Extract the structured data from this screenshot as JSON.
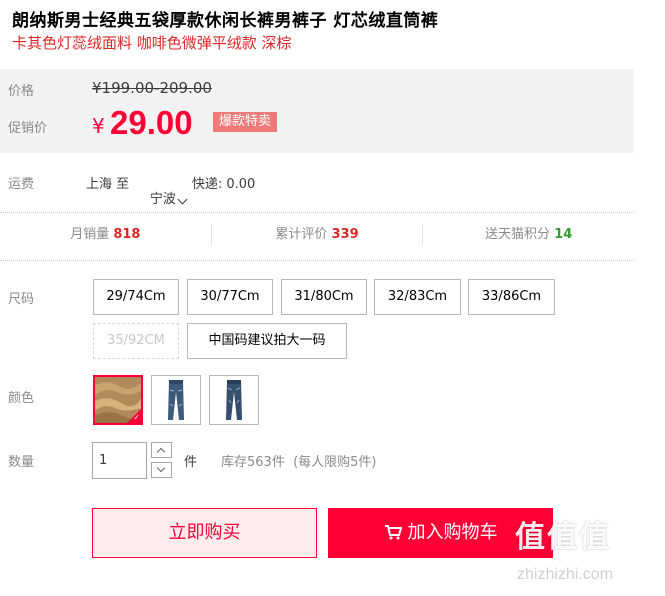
{
  "product": {
    "title": "朗纳斯男士经典五袋厚款休闲长裤男裤子 灯芯绒直筒裤",
    "subtitle": "卡其色灯蕊绒面料 咖啡色微弹平绒款 深棕"
  },
  "price": {
    "label": "价格",
    "original": "¥199.00-209.00",
    "promo_label": "促销价",
    "currency_symbol": "¥",
    "promo_value": "29.00",
    "promo_tag": "爆款特卖"
  },
  "shipping": {
    "label": "运费",
    "from": "上海",
    "to_word": "至",
    "destination": "宁波",
    "method": "快递: 0.00"
  },
  "stats": [
    {
      "label": "月销量",
      "value": "818"
    },
    {
      "label": "累计评价",
      "value": "339"
    },
    {
      "label": "送天猫积分",
      "value": "14"
    }
  ],
  "size": {
    "label": "尺码",
    "options": [
      {
        "label": "29/74Cm",
        "available": true
      },
      {
        "label": "30/77Cm",
        "available": true
      },
      {
        "label": "31/80Cm",
        "available": true
      },
      {
        "label": "32/83Cm",
        "available": true
      },
      {
        "label": "33/86Cm",
        "available": true
      },
      {
        "label": "35/92CM",
        "available": false
      },
      {
        "label": "中国码建议拍大一码",
        "available": true
      }
    ]
  },
  "color": {
    "label": "颜色",
    "options": [
      {
        "name": "khaki-corduroy",
        "selected": true
      },
      {
        "name": "jeans-blue-1",
        "selected": false
      },
      {
        "name": "jeans-blue-2",
        "selected": false
      }
    ]
  },
  "quantity": {
    "label": "数量",
    "value": "1",
    "unit": "件",
    "stock_text": "库存563件  (每人限购5件)"
  },
  "actions": {
    "buy_now": "立即购买",
    "add_to_cart": "加入购物车"
  },
  "watermark": {
    "text": "值值值",
    "sub": "zhizhizhi.com"
  },
  "colors": {
    "accent": "#ff0036",
    "title_red": "#dd2727",
    "points_green": "#339933"
  }
}
